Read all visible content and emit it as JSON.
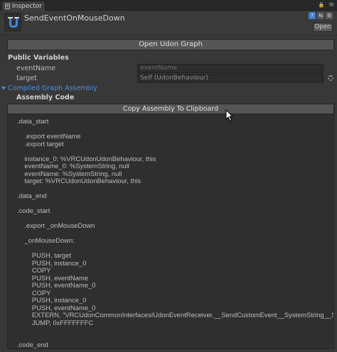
{
  "tab": {
    "label": "Inspector"
  },
  "tabbar_right": {
    "lock_glyph": "🔒",
    "menu_glyph": "≡"
  },
  "header": {
    "title": "SendEventOnMouseDown",
    "open_label": "Open",
    "help_glyph": "?",
    "preset_glyph": "⇆",
    "settings_glyph": "⚙"
  },
  "open_graph_button": "Open Udon Graph",
  "public_variables": {
    "heading": "Public Variables",
    "rows": [
      {
        "label": "eventName",
        "value": "eventName"
      },
      {
        "label": "target",
        "value": "Self (UdonBehaviour)"
      }
    ]
  },
  "compiled_graph_assembly": "Compiled Graph Assembly",
  "assembly_code_heading": "Assembly Code",
  "copy_button": "Copy Assembly To Clipboard",
  "assembly_code": ".data_start\n\n    .export eventName\n    .export target\n\n    instance_0: %VRCUdonUdonBehaviour, this\n    eventName_0: %SystemString, null\n    eventName: %SystemString, null\n    target: %VRCUdonUdonBehaviour, this\n\n.data_end\n\n.code_start\n\n    .export _onMouseDown\n\n    _onMouseDown:\n\n        PUSH, target\n        PUSH, instance_0\n        COPY\n        PUSH, eventName\n        PUSH, eventName_0\n        COPY\n        PUSH, instance_0\n        PUSH, eventName_0\n        EXTERN, \"VRCUdonCommonInterfacesIUdonEventReceiver.__SendCustomEvent__SystemString__SystemVoid\"\n        JUMP, 0xFFFFFFFC\n\n\n.code_end",
  "colors": {
    "accent": "#4f8edc",
    "background": "#383838",
    "code_background": "#2f2f2f"
  }
}
